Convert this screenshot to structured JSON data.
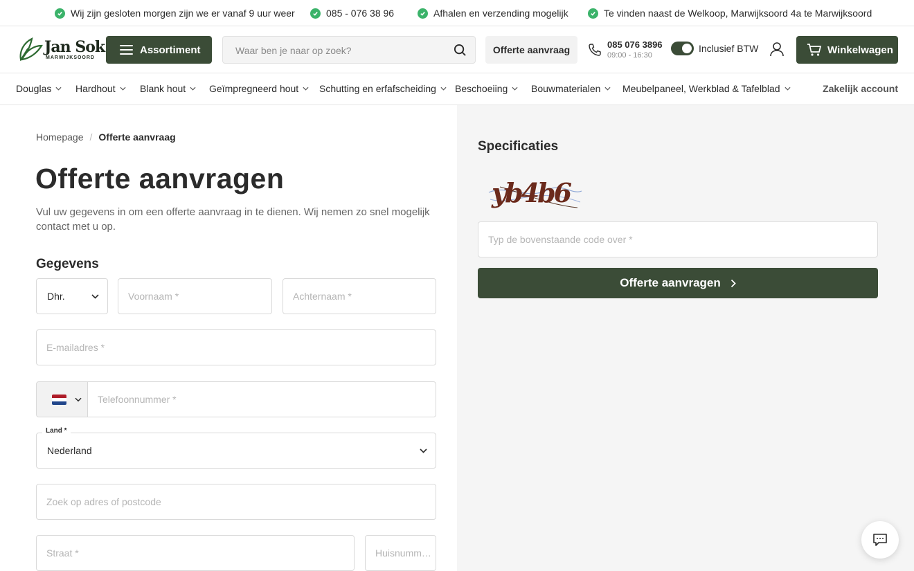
{
  "usp": [
    {
      "text": "Wij zijn gesloten morgen zijn we er vanaf 9 uur weer"
    },
    {
      "text": "085 - 076 38 96"
    },
    {
      "text": "Afhalen en verzending mogelijk"
    },
    {
      "text": "Te vinden naast de Welkoop, Marwijksoord 4a te Marwijksoord"
    }
  ],
  "header": {
    "logo_name": "Jan Sok",
    "logo_sub": "MARWIJKSOORD",
    "assortiment_label": "Assortiment",
    "search_placeholder": "Waar ben je naar op zoek?",
    "offerte_label": "Offerte aanvraag",
    "phone_number": "085 076 3896",
    "phone_hours": "09:00 - 16:30",
    "btw_label": "Inclusief BTW",
    "btw_enabled": true,
    "cart_label": "Winkelwagen"
  },
  "nav": {
    "items": [
      {
        "label": "Douglas"
      },
      {
        "label": "Hardhout"
      },
      {
        "label": "Blank hout"
      },
      {
        "label": "Geïmpregneerd hout"
      },
      {
        "label": "Schutting en erfafscheiding"
      },
      {
        "label": "Beschoeiing"
      },
      {
        "label": "Bouwmaterialen"
      },
      {
        "label": "Meubelpaneel, Werkblad & Tafelblad"
      }
    ],
    "business_label": "Zakelijk account"
  },
  "breadcrumb": {
    "home": "Homepage",
    "separator": "/",
    "current": "Offerte aanvraag"
  },
  "form": {
    "title": "Offerte aanvragen",
    "intro": "Vul uw gegevens in om een offerte aanvraag in te dienen. Wij nemen zo snel mogelijk contact met u op.",
    "section_title": "Gegevens",
    "salutation_value": "Dhr.",
    "firstname_placeholder": "Voornaam *",
    "lastname_placeholder": "Achternaam *",
    "email_placeholder": "E-mailadres *",
    "phone_placeholder": "Telefoonnummer *",
    "country_label": "Land *",
    "country_value": "Nederland",
    "address_search_placeholder": "Zoek op adres of postcode",
    "street_placeholder": "Straat *",
    "housenumber_placeholder": "Huisnummer *"
  },
  "specs": {
    "title": "Specificaties",
    "captcha_text": "yb4b6",
    "captcha_placeholder": "Typ de bovenstaande code over *",
    "submit_label": "Offerte aanvragen"
  },
  "colors": {
    "brand_green": "#3b4c37",
    "check_green": "#3bb36a"
  }
}
